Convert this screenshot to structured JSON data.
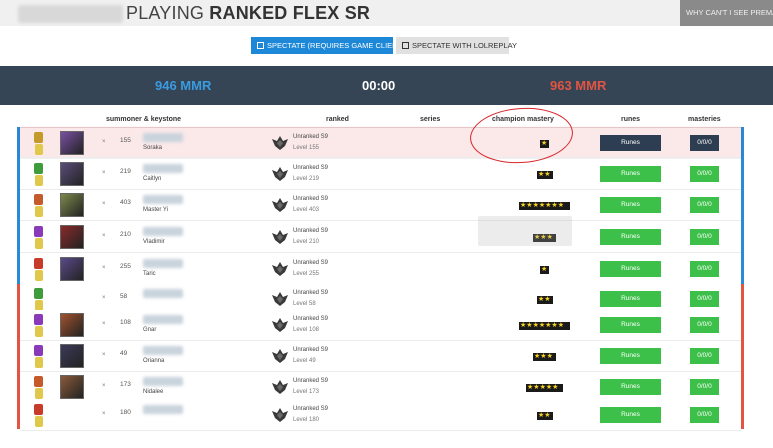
{
  "header": {
    "title_prefix": "PLAYING ",
    "title_bold": "RANKED FLEX SR",
    "why_cant": "WHY CAN'T I SEE PREMADES"
  },
  "actions": {
    "spectate_label": "SPECTATE (REQUIRES GAME CLIENT)",
    "lolreplay_label": "SPECTATE WITH LOLREPLAY"
  },
  "score": {
    "blue_mmr": "946 MMR",
    "timer": "00:00",
    "red_mmr": "963 MMR"
  },
  "columns": {
    "summoner": "summoner & keystone",
    "ranked": "ranked",
    "series": "series",
    "mastery": "champion mastery",
    "runes": "runes",
    "masteries": "masteries"
  },
  "colors": {
    "blue_team": "#2b8ad8",
    "red_team": "#e35442",
    "runes_green": "#3cc04a",
    "dark_button": "#2e3e52",
    "annotation": "#d9242a"
  },
  "players": [
    {
      "x": "×",
      "level": "155",
      "champion": "Soraka",
      "rank": "Unranked S9",
      "rank_level": "Level 155",
      "mastery_stars": 1,
      "runes": "Runes",
      "masteries": "0/0/0",
      "ks_color": "#c59a2a",
      "champ_color": "#7a4fa3"
    },
    {
      "x": "×",
      "level": "219",
      "champion": "Caitlyn",
      "rank": "Unranked S9",
      "rank_level": "Level 219",
      "mastery_stars": 2,
      "runes": "Runes",
      "masteries": "0/0/0",
      "ks_color": "#3f9c3a",
      "champ_color": "#5a4d7a"
    },
    {
      "x": "×",
      "level": "403",
      "champion": "Master Yi",
      "rank": "Unranked S9",
      "rank_level": "Level 403",
      "mastery_stars": 7,
      "runes": "Runes",
      "masteries": "0/0/0",
      "ks_color": "#c55a2a",
      "champ_color": "#7c8a4a"
    },
    {
      "x": "×",
      "level": "210",
      "champion": "Vladimir",
      "rank": "Unranked S9",
      "rank_level": "Level 210",
      "mastery_stars": 3,
      "runes": "Runes",
      "masteries": "0/0/0",
      "ks_color": "#8a3ab8",
      "champ_color": "#8a2a2a"
    },
    {
      "x": "×",
      "level": "255",
      "champion": "Taric",
      "rank": "Unranked S9",
      "rank_level": "Level 255",
      "mastery_stars": 1,
      "runes": "Runes",
      "masteries": "0/0/0",
      "ks_color": "#c83a2a",
      "champ_color": "#5a4a8a"
    },
    {
      "x": "×",
      "level": "58",
      "champion": "",
      "rank": "Unranked S9",
      "rank_level": "Level 58",
      "mastery_stars": 2,
      "runes": "Runes",
      "masteries": "0/0/0",
      "ks_color": "#3f9c3a",
      "champ_color": ""
    },
    {
      "x": "×",
      "level": "108",
      "champion": "Gnar",
      "rank": "Unranked S9",
      "rank_level": "Level 108",
      "mastery_stars": 7,
      "runes": "Runes",
      "masteries": "0/0/0",
      "ks_color": "#8a3ab8",
      "champ_color": "#a0522d"
    },
    {
      "x": "×",
      "level": "49",
      "champion": "Orianna",
      "rank": "Unranked S9",
      "rank_level": "Level 49",
      "mastery_stars": 3,
      "runes": "Runes",
      "masteries": "0/0/0",
      "ks_color": "#8a3ab8",
      "champ_color": "#3a3a5a"
    },
    {
      "x": "×",
      "level": "173",
      "champion": "Nidalee",
      "rank": "Unranked S9",
      "rank_level": "Level 173",
      "mastery_stars": 5,
      "runes": "Runes",
      "masteries": "0/0/0",
      "ks_color": "#c55a2a",
      "champ_color": "#8a5a3a"
    },
    {
      "x": "×",
      "level": "180",
      "champion": "",
      "rank": "Unranked S9",
      "rank_level": "Level 180",
      "mastery_stars": 2,
      "runes": "Runes",
      "masteries": "0/0/0",
      "ks_color": "#c83a2a",
      "champ_color": ""
    }
  ]
}
